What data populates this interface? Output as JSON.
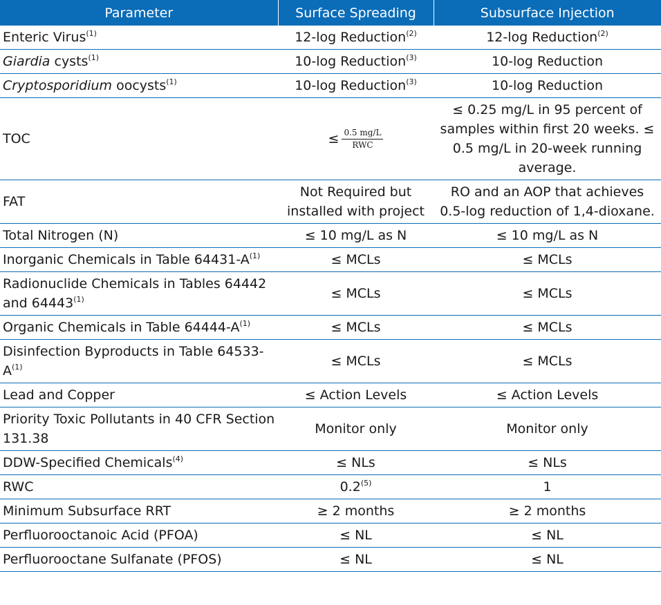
{
  "headers": [
    "Parameter",
    "Surface Spreading",
    "Subsurface Injection"
  ],
  "rows": [
    {
      "param": "Enteric Virus",
      "param_sup": "(1)",
      "surface": "12-log Reduction",
      "surface_sup": "(2)",
      "subsurface": "12-log Reduction",
      "subsurface_sup": "(2)"
    },
    {
      "param_italic": "Giardia",
      "param": " cysts",
      "param_sup": "(1)",
      "surface": "10-log Reduction",
      "surface_sup": "(3)",
      "subsurface": "10-log Reduction"
    },
    {
      "param_italic": "Cryptosporidium",
      "param": " oocysts",
      "param_sup": "(1)",
      "surface": "10-log Reduction",
      "surface_sup": "(3)",
      "subsurface": "10-log Reduction"
    },
    {
      "param": "TOC",
      "surface_prefix": "≤",
      "surface_num": "0.5 mg/L",
      "surface_den": "RWC",
      "subsurface": "≤ 0.25 mg/L in 95 percent of samples within first 20 weeks. ≤ 0.5 mg/L in 20-week running average."
    },
    {
      "param": "FAT",
      "surface": "Not Required but installed with project",
      "subsurface": "RO and an AOP that achieves 0.5-log reduction of 1,4-dioxane."
    },
    {
      "param": "Total Nitrogen (N)",
      "surface": "≤ 10 mg/L as N",
      "subsurface": "≤ 10 mg/L as N"
    },
    {
      "param": "Inorganic Chemicals in Table 64431-A",
      "param_sup": "(1)",
      "surface": "≤ MCLs",
      "subsurface": "≤ MCLs"
    },
    {
      "param": "Radionuclide Chemicals in Tables 64442 and 64443",
      "param_sup": "(1)",
      "surface": "≤ MCLs",
      "subsurface": "≤ MCLs"
    },
    {
      "param": "Organic Chemicals in Table 64444-A",
      "param_sup": "(1)",
      "surface": "≤ MCLs",
      "subsurface": "≤ MCLs"
    },
    {
      "param": "Disinfection Byproducts in Table 64533-A",
      "param_sup": "(1)",
      "surface": "≤ MCLs",
      "subsurface": "≤ MCLs"
    },
    {
      "param": "Lead and Copper",
      "surface": "≤ Action Levels",
      "subsurface": "≤ Action Levels"
    },
    {
      "param": "Priority Toxic Pollutants in 40 CFR Section 131.38",
      "surface": "Monitor only",
      "subsurface": "Monitor only"
    },
    {
      "param": "DDW-Specified Chemicals",
      "param_sup": "(4)",
      "surface": "≤ NLs",
      "subsurface": "≤ NLs"
    },
    {
      "param": "RWC",
      "surface": "0.2",
      "surface_sup": "(5)",
      "subsurface": "1"
    },
    {
      "param": "Minimum Subsurface RRT",
      "surface": "≥ 2 months",
      "subsurface": "≥ 2 months"
    },
    {
      "param": "Perfluorooctanoic Acid (PFOA)",
      "surface": "≤ NL",
      "subsurface": "≤ NL"
    },
    {
      "param": "Perfluorooctane Sulfanate (PFOS)",
      "surface": "≤ NL",
      "subsurface": "≤ NL"
    }
  ]
}
